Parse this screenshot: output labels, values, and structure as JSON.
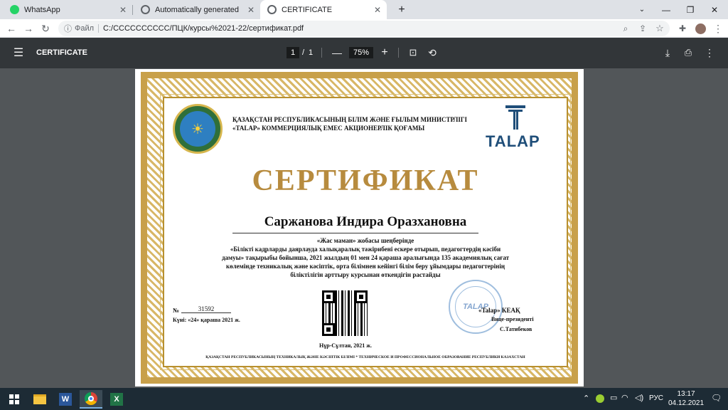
{
  "tabs": [
    {
      "title": "WhatsApp",
      "favicon_color": "#25d366"
    },
    {
      "title": "Automatically generated PDF fro",
      "favicon_color": "#5f6368"
    },
    {
      "title": "CERTIFICATE",
      "favicon_color": "#5f6368"
    }
  ],
  "window": {
    "minimize": "—",
    "restore": "❐",
    "close": "✕",
    "new_tab": "+"
  },
  "address": {
    "label": "Файл",
    "url": "C:/СССССССССС/ПЦК/курсы%2021-22/сертификат.pdf"
  },
  "pdf_toolbar": {
    "title": "CERTIFICATE",
    "page_current": "1",
    "page_sep": "/",
    "page_total": "1",
    "zoom": "75%",
    "zoom_out": "—",
    "zoom_in": "+"
  },
  "certificate": {
    "ministry_line1": "ҚАЗАҚСТАН РЕСПУБЛИКАСЫНЫҢ БІЛІМ ЖӘНЕ ҒЫЛЫМ МИНИСТРЛІГІ",
    "ministry_line2": "«TALAP» КОММЕРЦИЯЛЫҚ ЕМЕС АКЦИОНЕРЛІК ҚОҒАМЫ",
    "logo_text": "TALAP",
    "heading": "СЕРТИФИКАТ",
    "recipient": "Саржанова Индира Оразхановна",
    "body_line1": "«Жас маман» жобасы шеңберінде",
    "body_line2": "«Білікті кадрларды даярлауда халықаралық тәжірибені ескере отырып, педагогтердің кәсіби",
    "body_line3": "дамуы» тақырыбы бойынша, 2021 жылдың 01 мен 24 қараша аралығында 135 академиялық сағат",
    "body_line4": "көлемінде техникалық және кәсіптік, орта білімнен кейінгі білім беру ұйымдары педагогтерінің",
    "body_line5": "біліктілігін арттыру курсынан өткендігін растайды",
    "number_label": "№",
    "number_value": "31592",
    "issue_date": "Күні: «24» қараша 2021 ж.",
    "city": "Нұр-Сұлтан, 2021 ж.",
    "signer_org": "«Talap» КЕАҚ",
    "signer_title": "Вице-президенті",
    "signer_name": "С.Татибеков",
    "stamp_text": "TALAP",
    "footer": "ҚАЗАҚСТАН РЕСПУБЛИКАСЫНЫҢ ТЕХНИКАЛЫҚ ЖӘНЕ КӘСІПТІК БІЛІМІ * ТЕХНИЧЕСКОЕ И ПРОФЕССИОНАЛЬНОЕ ОБРАЗОВАНИЕ РЕСПУБЛИКИ КАЗАХСТАН"
  },
  "taskbar": {
    "lang": "РУС",
    "time": "13:17",
    "date": "04.12.2021",
    "apps": [
      "windows-start",
      "file-explorer",
      "word",
      "chrome",
      "excel"
    ]
  },
  "colors": {
    "gold": "#c8a04a",
    "heading": "#b78b3e",
    "talap_blue": "#1f4e79"
  }
}
